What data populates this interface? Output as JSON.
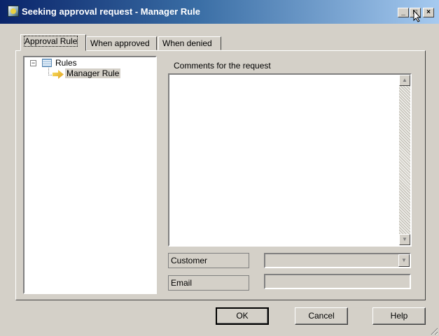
{
  "window": {
    "title": "Seeking approval request - Manager Rule",
    "controls": {
      "minimize": "_",
      "maximize": "□",
      "close": "×"
    }
  },
  "tabs": [
    {
      "label": "Approval Rule",
      "active": true
    },
    {
      "label": "When approved",
      "active": false
    },
    {
      "label": "When denied",
      "active": false
    }
  ],
  "tree": {
    "expander": "⊟",
    "root_label": "Rules",
    "child_label": "Manager Rule"
  },
  "form": {
    "comments_label": "Comments for the request",
    "comments_value": "",
    "customer_label": "Customer",
    "customer_value": "",
    "email_label": "Email",
    "email_value": ""
  },
  "buttons": {
    "ok": "OK",
    "cancel": "Cancel",
    "help": "Help"
  },
  "icons": {
    "app": "app-icon",
    "rules": "table-icon",
    "rule": "arrow-rule-icon",
    "scroll_up": "▲",
    "scroll_down": "▼",
    "combo": "▼"
  }
}
